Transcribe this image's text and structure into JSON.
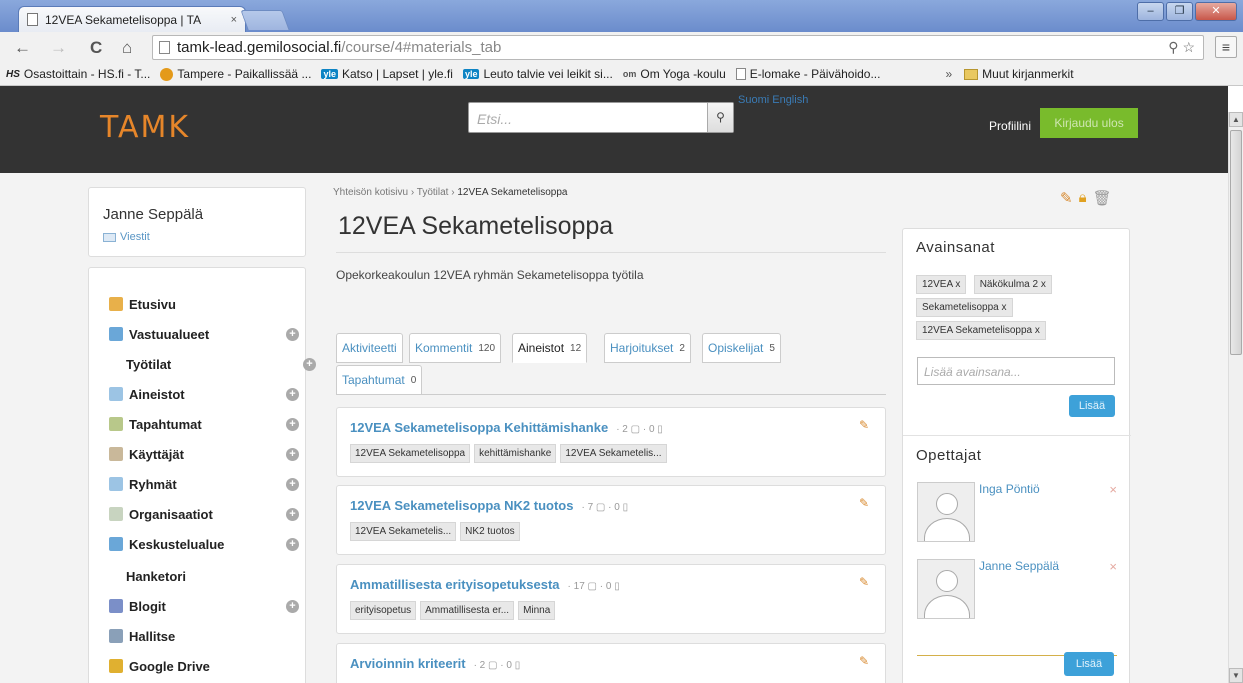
{
  "browser": {
    "tab_title": "12VEA Sekametelisoppa | TA",
    "tab_close": "×",
    "url_host": "tamk-lead.gemilosocial.fi",
    "url_path": "/course/4#materials_tab",
    "bookmarks": [
      {
        "icon": "hs",
        "icon_text": "HS",
        "label": "Osastoittain - HS.fi - T..."
      },
      {
        "icon": "globe",
        "icon_text": "",
        "label": "Tampere - Paikallissää ..."
      },
      {
        "icon": "yle",
        "icon_text": "yle",
        "label": "Katso | Lapset | yle.fi"
      },
      {
        "icon": "yle",
        "icon_text": "yle",
        "label": "Leuto talvie vei leikit si..."
      },
      {
        "icon": "om",
        "icon_text": "om",
        "label": "Om Yoga -koulu"
      },
      {
        "icon": "doc",
        "icon_text": "",
        "label": "E-lomake - Päivähoido..."
      }
    ],
    "bookmarks_more": "»",
    "other_bookmarks": "Muut kirjanmerkit"
  },
  "header": {
    "logo": "TAMK",
    "search_placeholder": "Etsi...",
    "languages": "Suomi English",
    "profile_link": "Profiilini",
    "logout_button": "Kirjaudu ulos"
  },
  "user": {
    "name": "Janne Seppälä",
    "messages_link": "Viestit"
  },
  "nav": [
    {
      "label": "Etusivu",
      "icon": "home-icon",
      "color": "#e8b04a",
      "plus": false,
      "sub": false
    },
    {
      "label": "Vastuualueet",
      "icon": "areas-icon",
      "color": "#6aa7d8",
      "plus": true,
      "sub": false
    },
    {
      "label": "Työtilat",
      "icon": "",
      "color": "",
      "plus": true,
      "sub": true
    },
    {
      "label": "Aineistot",
      "icon": "materials-icon",
      "color": "#9cc4e4",
      "plus": true,
      "sub": false
    },
    {
      "label": "Tapahtumat",
      "icon": "calendar-icon",
      "color": "#b8c88a",
      "plus": true,
      "sub": false
    },
    {
      "label": "Käyttäjät",
      "icon": "user-icon",
      "color": "#c9b89a",
      "plus": true,
      "sub": false
    },
    {
      "label": "Ryhmät",
      "icon": "group-icon",
      "color": "#9cc4e4",
      "plus": true,
      "sub": false
    },
    {
      "label": "Organisaatiot",
      "icon": "gear-icon",
      "color": "#c8d4c0",
      "plus": true,
      "sub": false
    },
    {
      "label": "Keskustelualue",
      "icon": "discussion-icon",
      "color": "#6aa7d8",
      "plus": true,
      "sub": false
    },
    {
      "label": "Hanketori",
      "icon": "",
      "color": "",
      "plus": false,
      "sub": true
    },
    {
      "label": "Blogit",
      "icon": "blog-icon",
      "color": "#7b8fc8",
      "plus": true,
      "sub": false
    },
    {
      "label": "Hallitse",
      "icon": "tools-icon",
      "color": "#8aa0b8",
      "plus": false,
      "sub": false
    },
    {
      "label": "Google Drive",
      "icon": "drive-icon",
      "color": "#e0b030",
      "plus": false,
      "sub": false
    }
  ],
  "breadcrumb": {
    "home": "Yhteisön kotisivu",
    "sep": "›",
    "section": "Työtilat",
    "current": "12VEA Sekametelisoppa"
  },
  "page": {
    "title": "12VEA Sekametelisoppa",
    "description": "Opekorkeakoulun 12VEA ryhmän Sekametelisoppa työtila"
  },
  "tabs": [
    {
      "label": "Aktiviteetti",
      "count": "",
      "active": false
    },
    {
      "label": "Kommentit",
      "count": "120",
      "active": false
    },
    {
      "label": "Aineistot",
      "count": "12",
      "active": true
    },
    {
      "label": "Harjoitukset",
      "count": "2",
      "active": false
    },
    {
      "label": "Opiskelijat",
      "count": "5",
      "active": false
    },
    {
      "label": "Tapahtumat",
      "count": "0",
      "active": false
    }
  ],
  "materials": [
    {
      "title": "12VEA Sekametelisoppa Kehittämishanke",
      "meta": "· 2 ▢ · 0 ▯",
      "tags": [
        "12VEA Sekametelisoppa",
        "kehittämishanke",
        "12VEA Sekametelis..."
      ]
    },
    {
      "title": "12VEA Sekametelisoppa NK2 tuotos",
      "meta": "· 7 ▢ · 0 ▯",
      "tags": [
        "12VEA Sekametelis...",
        "NK2 tuotos"
      ]
    },
    {
      "title": "Ammatillisesta erityisopetuksesta",
      "meta": "· 17 ▢ · 0 ▯",
      "tags": [
        "erityisopetus",
        "Ammatillisesta er...",
        "Minna"
      ]
    },
    {
      "title": "Arvioinnin kriteerit",
      "meta": "· 2 ▢ · 0 ▯",
      "tags": []
    }
  ],
  "sidebar": {
    "keywords_title": "Avainsanat",
    "keywords": [
      "12VEA x",
      "Näkökulma 2 x",
      "Sekametelisoppa x",
      "12VEA Sekametelisoppa x"
    ],
    "keyword_placeholder": "Lisää avainsana...",
    "add_button": "Lisää",
    "teachers_title": "Opettajat",
    "teachers": [
      {
        "name": "Inga Pöntiö",
        "remove": "×"
      },
      {
        "name": "Janne Seppälä",
        "remove": "×"
      }
    ],
    "add_teacher_button": "Lisää"
  }
}
